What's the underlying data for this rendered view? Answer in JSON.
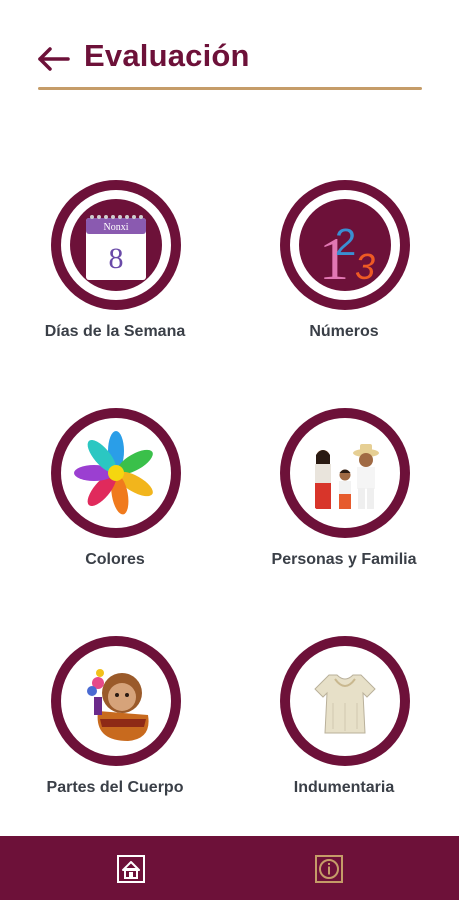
{
  "header": {
    "back_icon": "arrow-left-icon",
    "title": "Evaluación"
  },
  "categories": [
    {
      "label": "Días de la Semana",
      "icon": "calendar-icon",
      "calendar_header": "Nonxi",
      "calendar_day": "8"
    },
    {
      "label": "Números",
      "icon": "numbers-icon",
      "digits": [
        "1",
        "2",
        "3"
      ]
    },
    {
      "label": "Colores",
      "icon": "color-flower-icon"
    },
    {
      "label": "Personas y Familia",
      "icon": "family-icon"
    },
    {
      "label": "Partes del Cuerpo",
      "icon": "doll-icon"
    },
    {
      "label": "Indumentaria",
      "icon": "dress-icon"
    }
  ],
  "bottom_nav": {
    "home_icon": "home-icon",
    "info_icon": "info-icon"
  },
  "colors": {
    "primary": "#6d1139",
    "accent_rule": "#c59c68",
    "label_text": "#3a3f47",
    "info_icon": "#c59c68"
  }
}
